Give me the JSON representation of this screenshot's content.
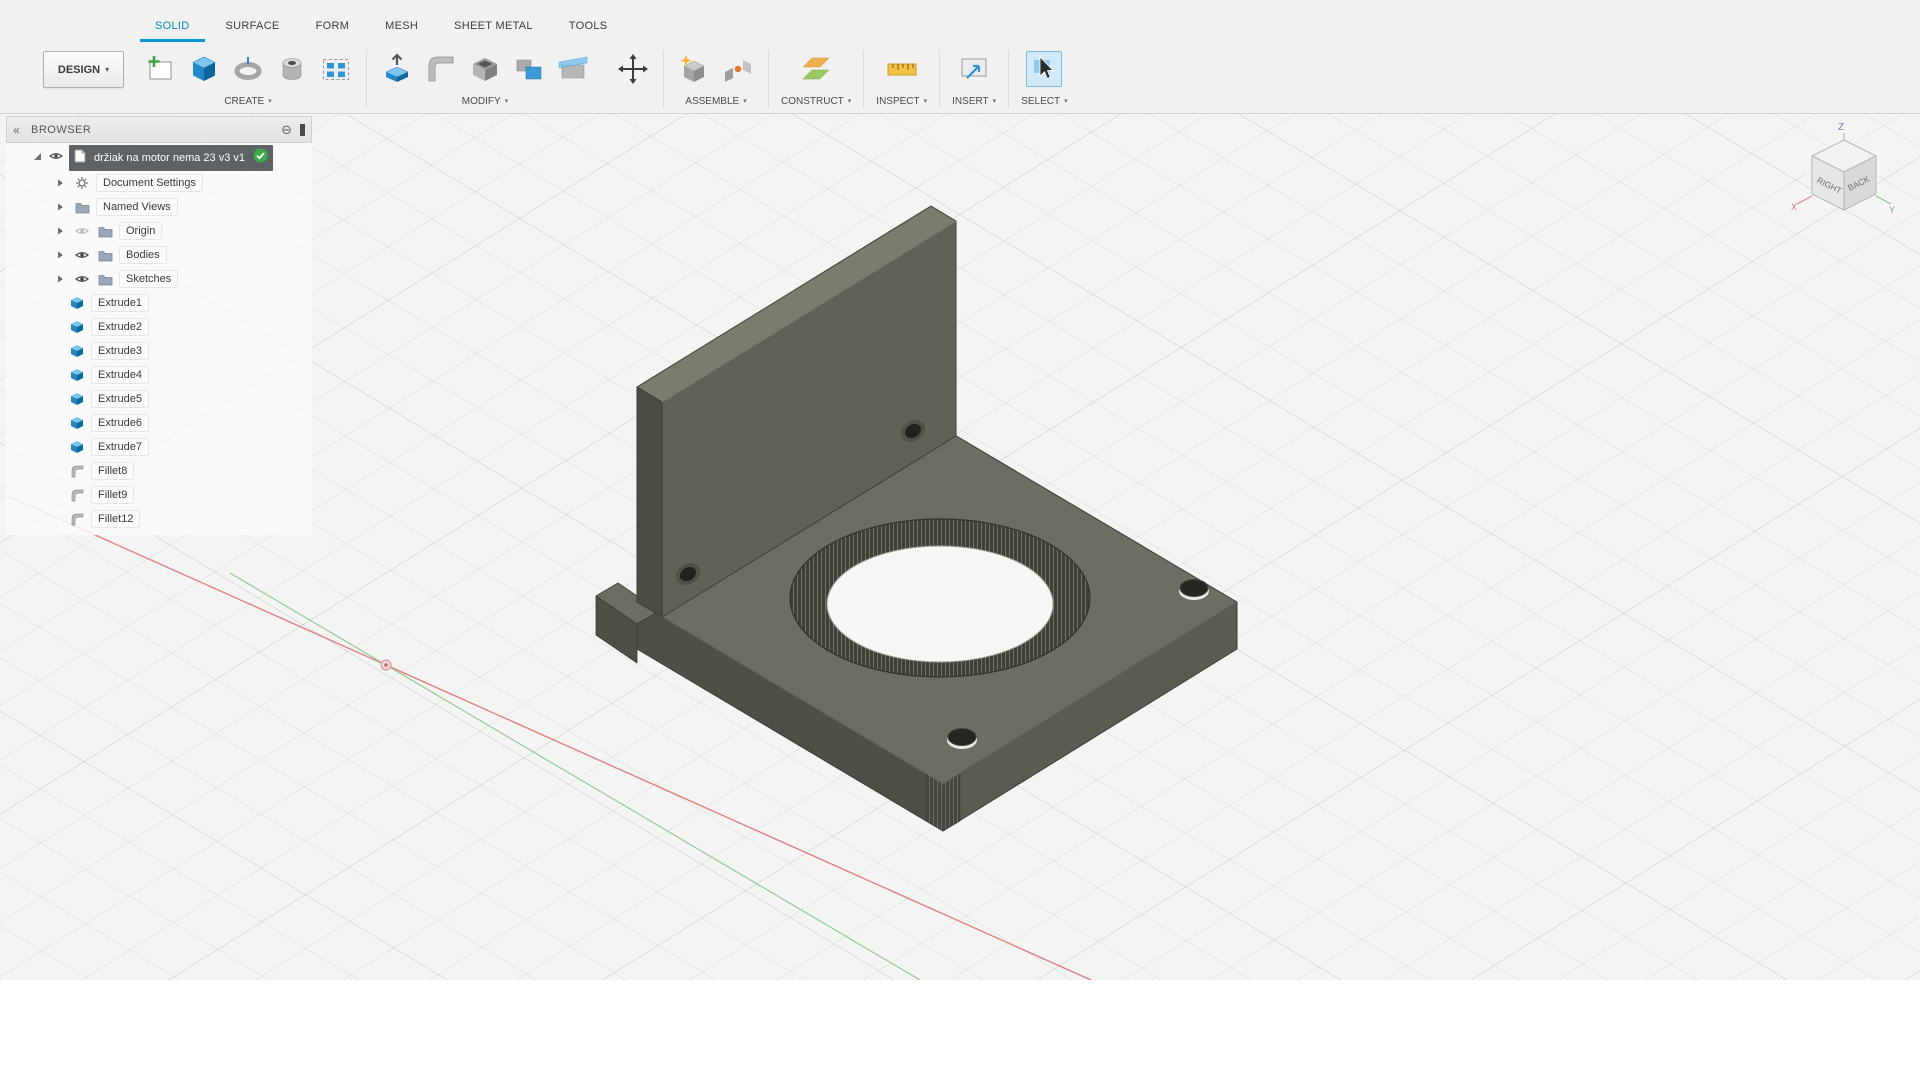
{
  "toolbar": {
    "design_button": "DESIGN",
    "tabs": [
      {
        "label": "SOLID",
        "active": true
      },
      {
        "label": "SURFACE",
        "active": false
      },
      {
        "label": "FORM",
        "active": false
      },
      {
        "label": "MESH",
        "active": false
      },
      {
        "label": "SHEET METAL",
        "active": false
      },
      {
        "label": "TOOLS",
        "active": false
      }
    ],
    "groups": [
      {
        "label": "CREATE",
        "icons": [
          "create-sketch",
          "extrude",
          "revolve",
          "hole",
          "pattern"
        ]
      },
      {
        "label": "MODIFY",
        "icons": [
          "press-pull",
          "fillet",
          "shell",
          "combine",
          "split"
        ]
      },
      {
        "label": "ASSEMBLE",
        "icons": [
          "new-component",
          "joint"
        ]
      },
      {
        "label": "CONSTRUCT",
        "icons": [
          "construction-plane"
        ]
      },
      {
        "label": "INSPECT",
        "icons": [
          "measure"
        ]
      },
      {
        "label": "INSERT",
        "icons": [
          "insert"
        ]
      },
      {
        "label": "SELECT",
        "icons": [
          "select-cursor"
        ]
      }
    ],
    "standalone_icons": [
      "move-transform"
    ]
  },
  "browser": {
    "title": "BROWSER",
    "root": {
      "label": "držiak na motor nema 23 v3 v1",
      "selected": true,
      "status_icon": "check-badge"
    },
    "items": [
      {
        "label": "Document Settings",
        "icon": "gear",
        "expandable": true
      },
      {
        "label": "Named Views",
        "icon": "folder",
        "expandable": true
      },
      {
        "label": "Origin",
        "icon": "folder",
        "expandable": true,
        "visibility": "hidden"
      },
      {
        "label": "Bodies",
        "icon": "folder",
        "expandable": true,
        "visibility": "visible"
      },
      {
        "label": "Sketches",
        "icon": "folder",
        "expandable": true,
        "visibility": "visible"
      },
      {
        "label": "Extrude1",
        "icon": "extrude-feature"
      },
      {
        "label": "Extrude2",
        "icon": "extrude-feature"
      },
      {
        "label": "Extrude3",
        "icon": "extrude-feature"
      },
      {
        "label": "Extrude4",
        "icon": "extrude-feature"
      },
      {
        "label": "Extrude5",
        "icon": "extrude-feature"
      },
      {
        "label": "Extrude6",
        "icon": "extrude-feature"
      },
      {
        "label": "Extrude7",
        "icon": "extrude-feature"
      },
      {
        "label": "Fillet8",
        "icon": "fillet-feature"
      },
      {
        "label": "Fillet9",
        "icon": "fillet-feature"
      },
      {
        "label": "Fillet12",
        "icon": "fillet-feature"
      }
    ]
  },
  "viewcube": {
    "left_face": "RIGHT",
    "right_face": "BACK",
    "axis_z": "Z",
    "axis_x": "X",
    "axis_y": "Y"
  },
  "colors": {
    "accent_blue": "#0696d7",
    "selection_dark": "#5d6266",
    "check_green": "#3bab46",
    "axis_x_red": "#e07b7b",
    "axis_y_green": "#94c994",
    "model_top": "#6d6d63",
    "model_front": "#616157",
    "model_side": "#4e4e46"
  }
}
